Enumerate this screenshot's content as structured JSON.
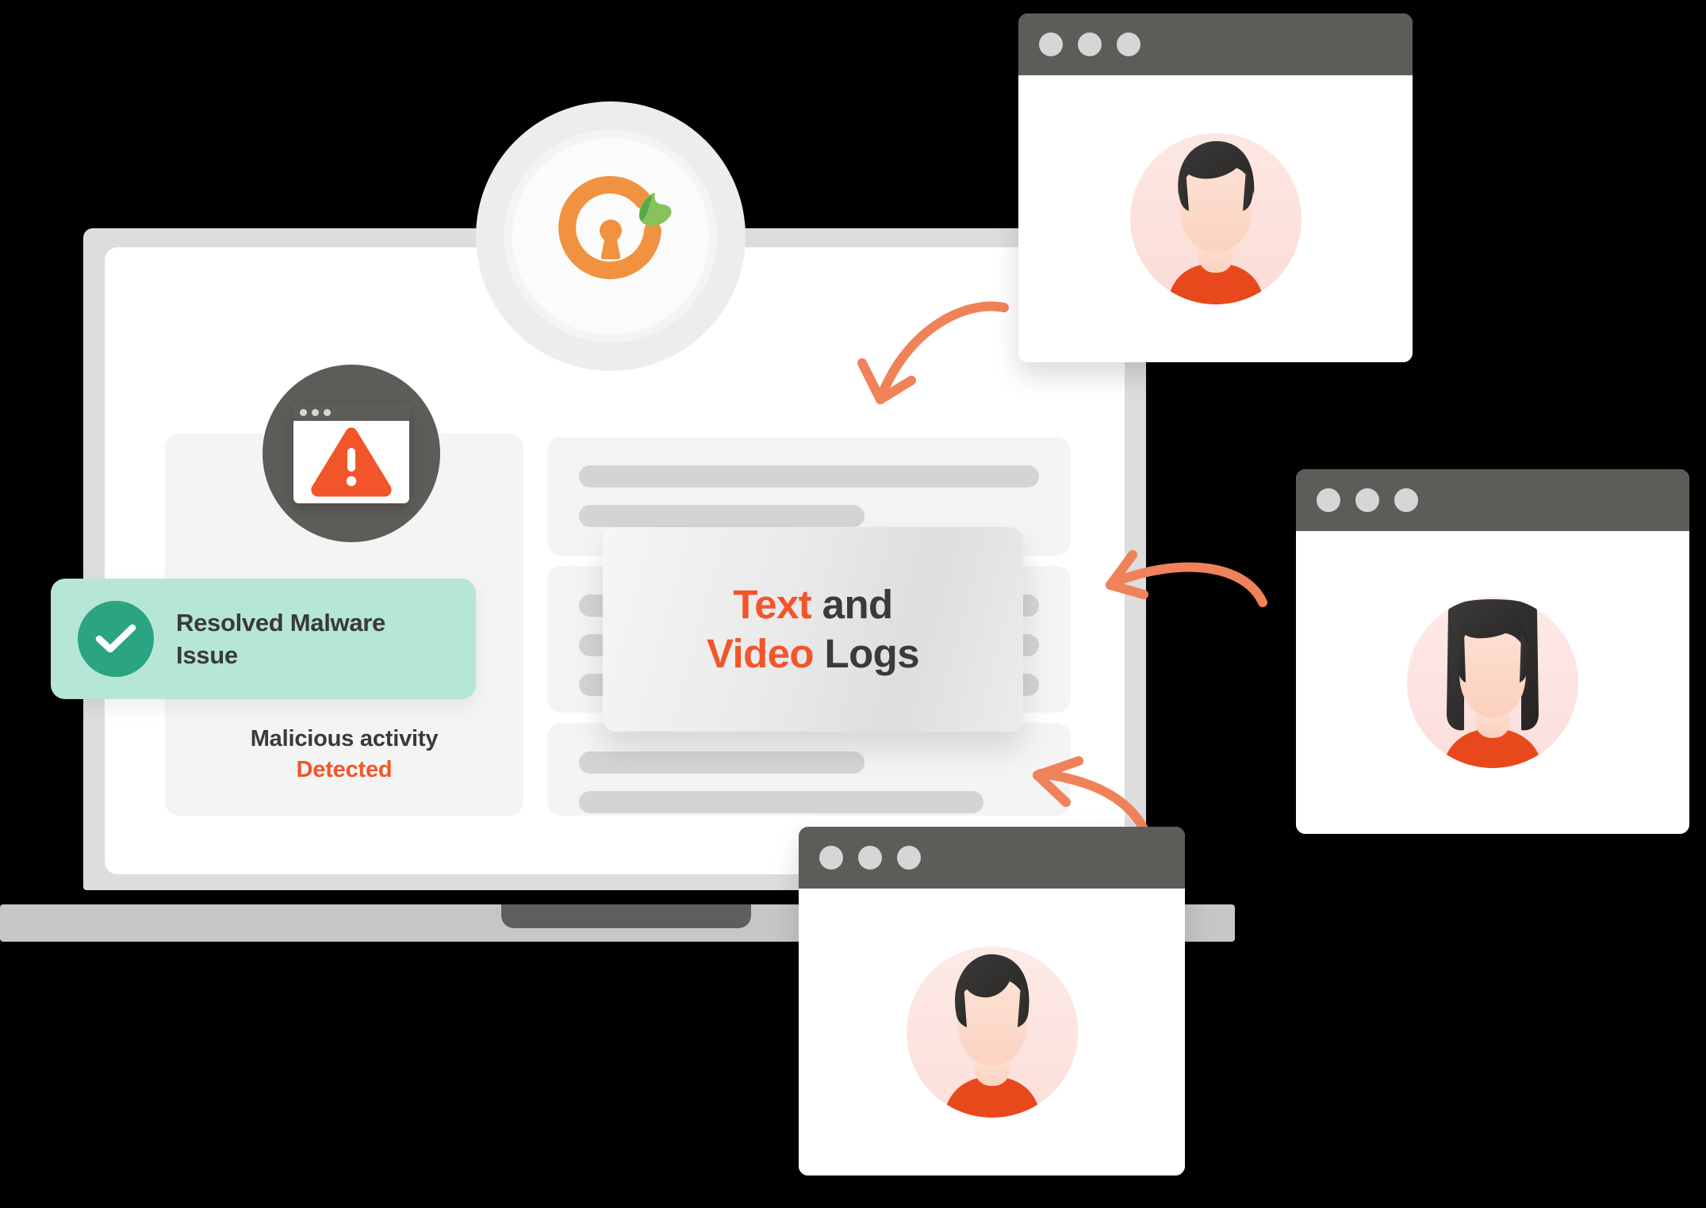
{
  "illustration": {
    "title": "Text and Video Logs monitoring illustration",
    "colors": {
      "accent_orange": "#f2552a",
      "logo_orange": "#f0923f",
      "leaf_green": "#7cbf5a",
      "badge_green_bg": "#b6e6d5",
      "check_green": "#2ba481",
      "dark_gray": "#5e5c59",
      "text_dark": "#3a3a38",
      "panel_gray": "#f4f4f4",
      "skeleton_gray": "#d4d4d4",
      "bezel_gray": "#dddddd",
      "base_gray": "#c6c6c6",
      "avatar_pink": "#fde3e0",
      "avatar_shirt": "#e8491c",
      "avatar_hair": "#33312f",
      "avatar_skin": "#fde0d2"
    }
  },
  "laptop": {
    "name": "laptop-mockup",
    "logo": {
      "icon": "circular-lock-leaf-logo",
      "lock_icon": "open-circle-lock-icon",
      "keyhole_icon": "keyhole-icon",
      "leaf_icon": "leaf-icon"
    },
    "left_panel": {
      "malware_icon": "malware-warning-window-icon",
      "warning_icon": "warning-triangle-icon",
      "caption_line1": "Malicious activity",
      "caption_line2": "Detected"
    },
    "resolved_badge": {
      "check_icon": "check-circle-icon",
      "label": "Resolved Malware Issue"
    },
    "text_card": {
      "line1_highlight": "Text",
      "line1_rest": " and",
      "line2_highlight": "Video",
      "line2_rest": " Logs"
    },
    "skeleton_panels": [
      {
        "name": "skeleton-panel-1",
        "lines": [
          100,
          62,
          88
        ]
      },
      {
        "name": "skeleton-panel-2",
        "lines": [
          20,
          20,
          20
        ]
      },
      {
        "name": "skeleton-panel-3",
        "lines": [
          100,
          62,
          88
        ]
      }
    ]
  },
  "browser_windows": [
    {
      "name": "browser-window-top",
      "avatar": "male-avatar-short-hair",
      "dots": 3
    },
    {
      "name": "browser-window-right",
      "avatar": "female-avatar-long-hair",
      "dots": 3
    },
    {
      "name": "browser-window-bottom",
      "avatar": "male-avatar-wavy-hair",
      "dots": 3
    }
  ],
  "arrows": [
    {
      "name": "arrow-top-to-screen",
      "direction": "down-left",
      "color": "#ef8259"
    },
    {
      "name": "arrow-right-to-screen",
      "direction": "left",
      "color": "#ef8259"
    },
    {
      "name": "arrow-bottom-to-screen",
      "direction": "up-left",
      "color": "#ef8259"
    }
  ]
}
